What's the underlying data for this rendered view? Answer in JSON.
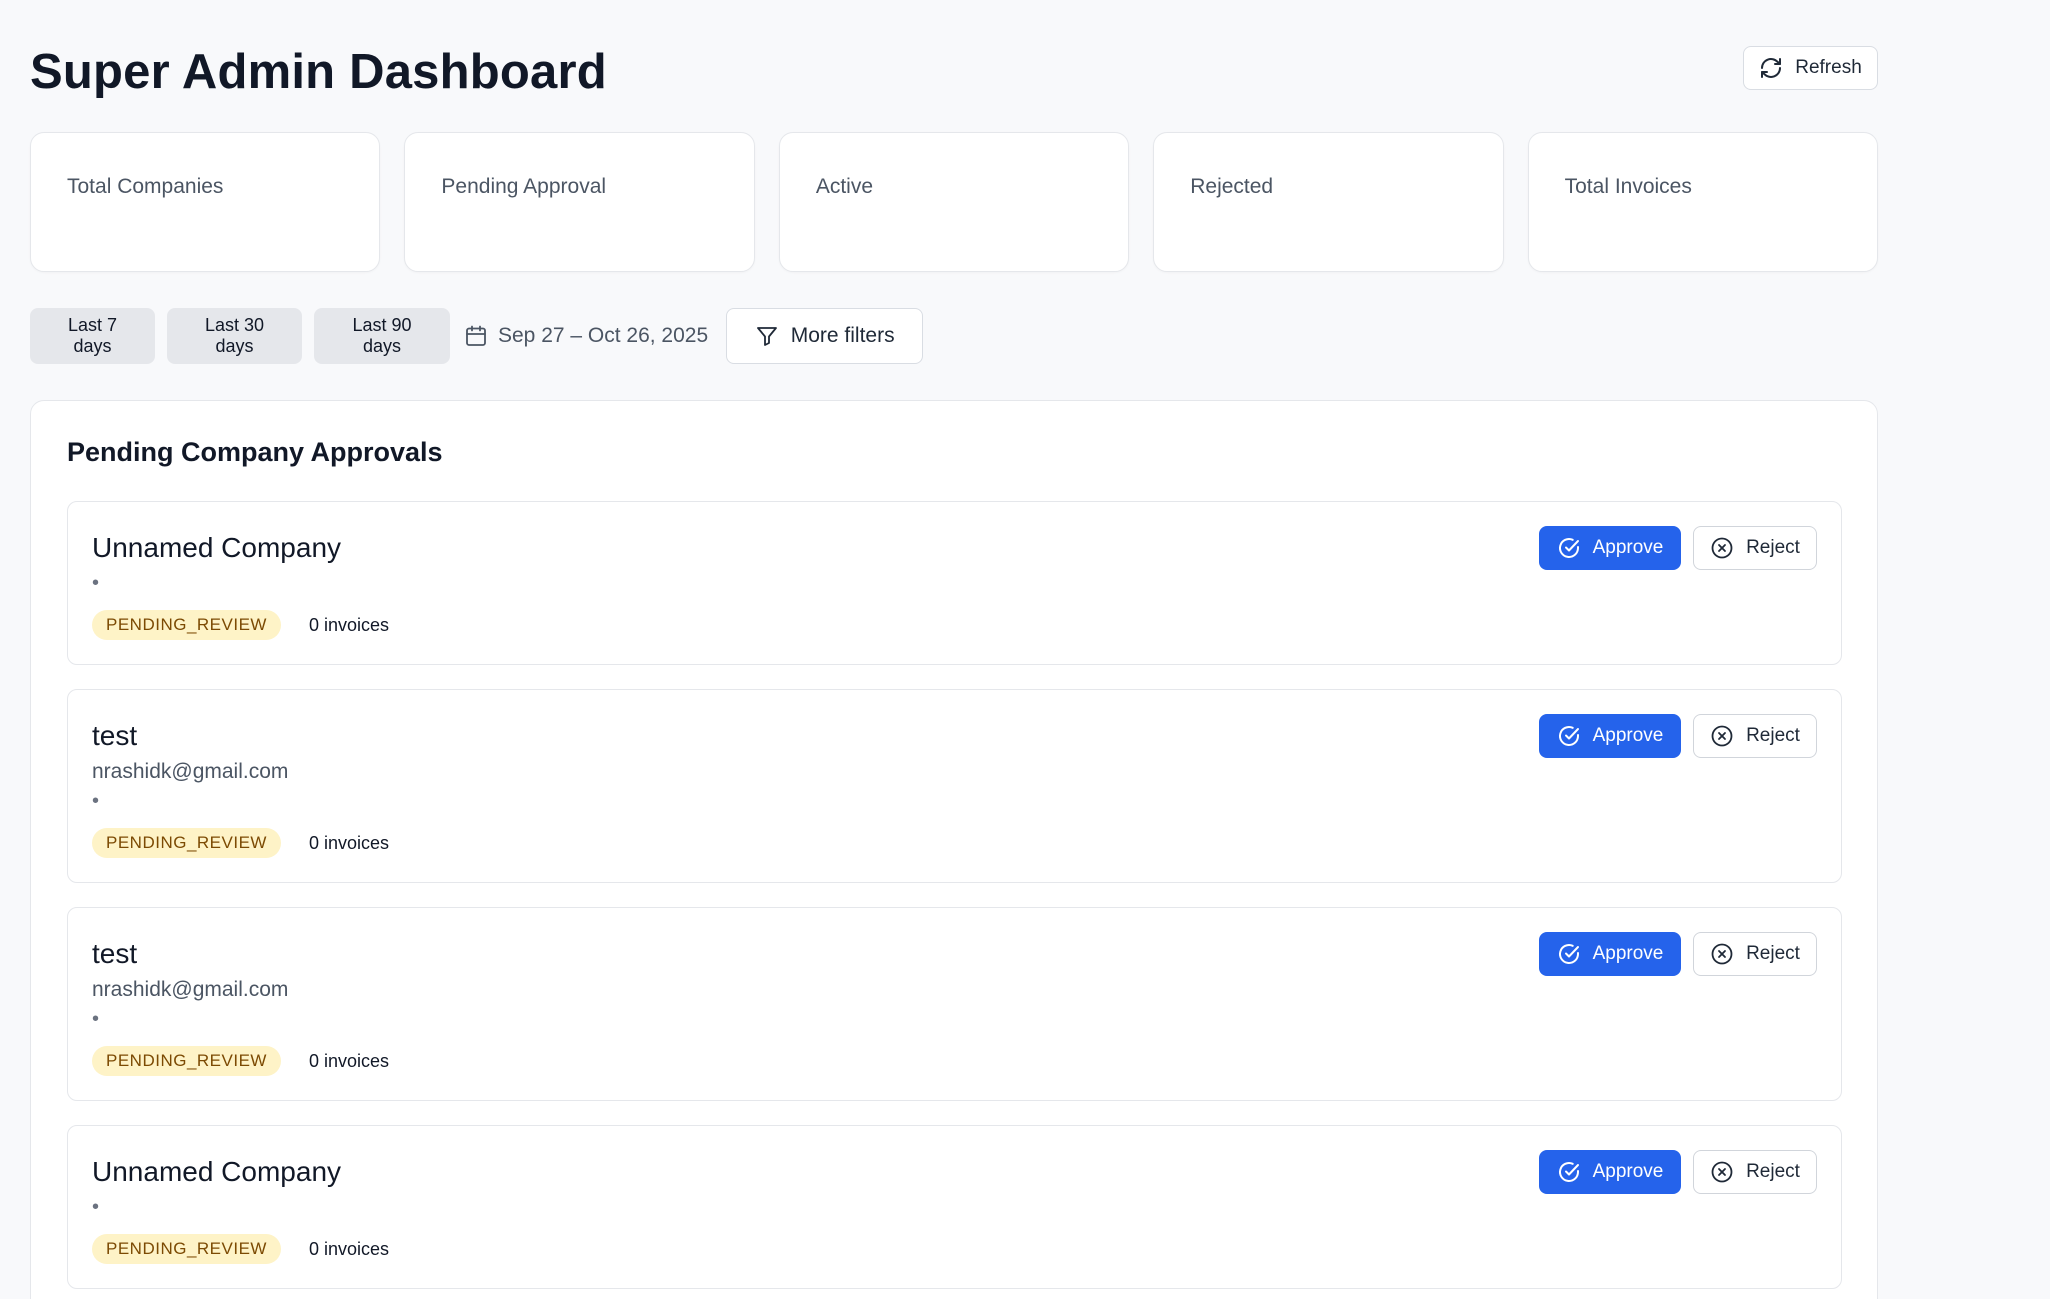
{
  "header": {
    "title": "Super Admin Dashboard",
    "refresh_label": "Refresh"
  },
  "stats": [
    {
      "label": "Total Companies"
    },
    {
      "label": "Pending Approval"
    },
    {
      "label": "Active"
    },
    {
      "label": "Rejected"
    },
    {
      "label": "Total Invoices"
    }
  ],
  "filters": {
    "presets": [
      "Last 7 days",
      "Last 30 days",
      "Last 90 days"
    ],
    "date_range": "Sep 27 – Oct 26, 2025",
    "more_filters_label": "More filters"
  },
  "approvals": {
    "title": "Pending Company Approvals",
    "approve_label": "Approve",
    "reject_label": "Reject",
    "items": [
      {
        "name": "Unnamed Company",
        "email": "",
        "bullet": "•",
        "status": "PENDING_REVIEW",
        "invoices": "0 invoices"
      },
      {
        "name": "test",
        "email": "nrashidk@gmail.com",
        "bullet": "•",
        "status": "PENDING_REVIEW",
        "invoices": "0 invoices"
      },
      {
        "name": "test",
        "email": "nrashidk@gmail.com",
        "bullet": "•",
        "status": "PENDING_REVIEW",
        "invoices": "0 invoices"
      },
      {
        "name": "Unnamed Company",
        "email": "",
        "bullet": "•",
        "status": "PENDING_REVIEW",
        "invoices": "0 invoices"
      }
    ]
  },
  "colors": {
    "primary": "#2563eb",
    "badge_bg": "#fef3c7",
    "badge_text": "#7c4a03"
  }
}
